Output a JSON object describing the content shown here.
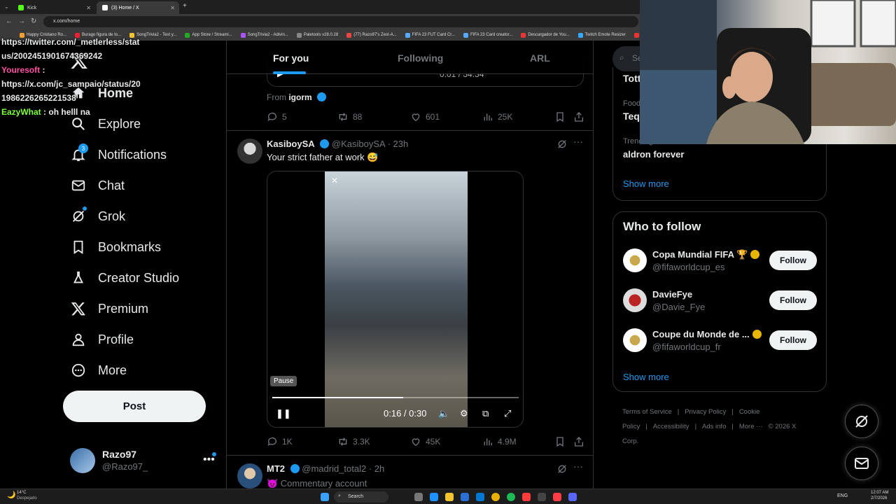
{
  "browser": {
    "tabs": [
      {
        "label": "Kick"
      },
      {
        "label": "(3) Home / X"
      }
    ],
    "url": "x.com/home",
    "bookmarks": [
      "Happy Cristiano Ro...",
      "Burago figura de to...",
      "SongTrivia2 - Test y...",
      "App Store / Streami...",
      "SongTrivia2 - Adivin...",
      "Paletools v28.0.28",
      "(77) Razo97's Zest-A...",
      "FIFA 23 FUT Card Cr...",
      "FIFA 23 Card creator...",
      "Descargador de You...",
      "Twitch Emote Resizer",
      "twitch emote re"
    ]
  },
  "chat": {
    "lines": [
      {
        "text": "https://twitter.com/_metlerless/stat"
      },
      {
        "text": "us/2002451901674369242"
      },
      {
        "user": "Youresoft",
        "sep": " :",
        "text": ""
      },
      {
        "text": "https://x.com/jc_sampaio/status/20"
      },
      {
        "text": "1986226265221538"
      },
      {
        "user": "EazyWhat",
        "sep": " :",
        "text": " oh helll na"
      }
    ],
    "colors": {
      "youresoft": "#ff4fa3",
      "eazywhat": "#7dff3a"
    }
  },
  "sidebar": {
    "items": [
      {
        "label": "Home",
        "icon": "home-icon"
      },
      {
        "label": "Explore",
        "icon": "search-icon"
      },
      {
        "label": "Notifications",
        "icon": "bell-icon",
        "badge": "3"
      },
      {
        "label": "Chat",
        "icon": "mail-icon"
      },
      {
        "label": "Grok",
        "icon": "grok-icon"
      },
      {
        "label": "Bookmarks",
        "icon": "bookmark-icon"
      },
      {
        "label": "Creator Studio",
        "icon": "flask-icon"
      },
      {
        "label": "Premium",
        "icon": "x-icon"
      },
      {
        "label": "Profile",
        "icon": "person-icon"
      },
      {
        "label": "More",
        "icon": "more-icon"
      }
    ],
    "post_label": "Post",
    "profile": {
      "name": "Razo97",
      "handle": "@Razo97_",
      "more": "•••"
    }
  },
  "feed": {
    "tabs": [
      {
        "label": "For you"
      },
      {
        "label": "Following"
      },
      {
        "label": "ARL"
      }
    ],
    "prev_post": {
      "video_time": "0:01 / 34:34",
      "from_label": "From",
      "from_user": "igorm",
      "replies": "5",
      "reposts": "88",
      "likes": "601",
      "views": "25K"
    },
    "post": {
      "name": "KasiboySA",
      "handle": "@KasiboySA",
      "time": "· 23h",
      "text": "Your strict father at work 😅",
      "video_time": "0:16 / 0:30",
      "pause_tooltip": "Pause",
      "progress": 0.53,
      "replies": "1K",
      "reposts": "3.3K",
      "likes": "45K",
      "views": "4.9M"
    },
    "next_post": {
      "name": "MT2",
      "handle": "@madrid_total2",
      "time": "· 2h",
      "text": "😈 Commentary account"
    }
  },
  "right": {
    "search_placeholder": "Se",
    "trends": [
      {
        "category": "",
        "title": "Tott"
      },
      {
        "category": "Food",
        "title": "Teq"
      },
      {
        "category": "Trending in Mexico",
        "title": "aldron forever"
      }
    ],
    "trends_show_more": "Show more",
    "who_to_follow_title": "Who to follow",
    "suggestions": [
      {
        "name": "Copa Mundial FIFA 🏆",
        "handle": "@fifaworldcup_es",
        "button": "Follow"
      },
      {
        "name": "DavieFye",
        "handle": "@Davie_Fye",
        "button": "Follow"
      },
      {
        "name": "Coupe du Monde de ...",
        "handle": "@fifaworldcup_fr",
        "button": "Follow"
      }
    ],
    "wtf_show_more": "Show more",
    "footer": [
      "Terms of Service",
      "|",
      "Privacy Policy",
      "|",
      "Cookie Policy",
      "|",
      "Accessibility",
      "|",
      "Ads info",
      "|",
      "More ···",
      "© 2026 X Corp."
    ]
  },
  "taskbar": {
    "weather_temp": "14°C",
    "weather_desc": "Despejado",
    "search_label": "Search",
    "lang": "ENG",
    "time": "12:07 AM",
    "date": "2/7/2026"
  }
}
